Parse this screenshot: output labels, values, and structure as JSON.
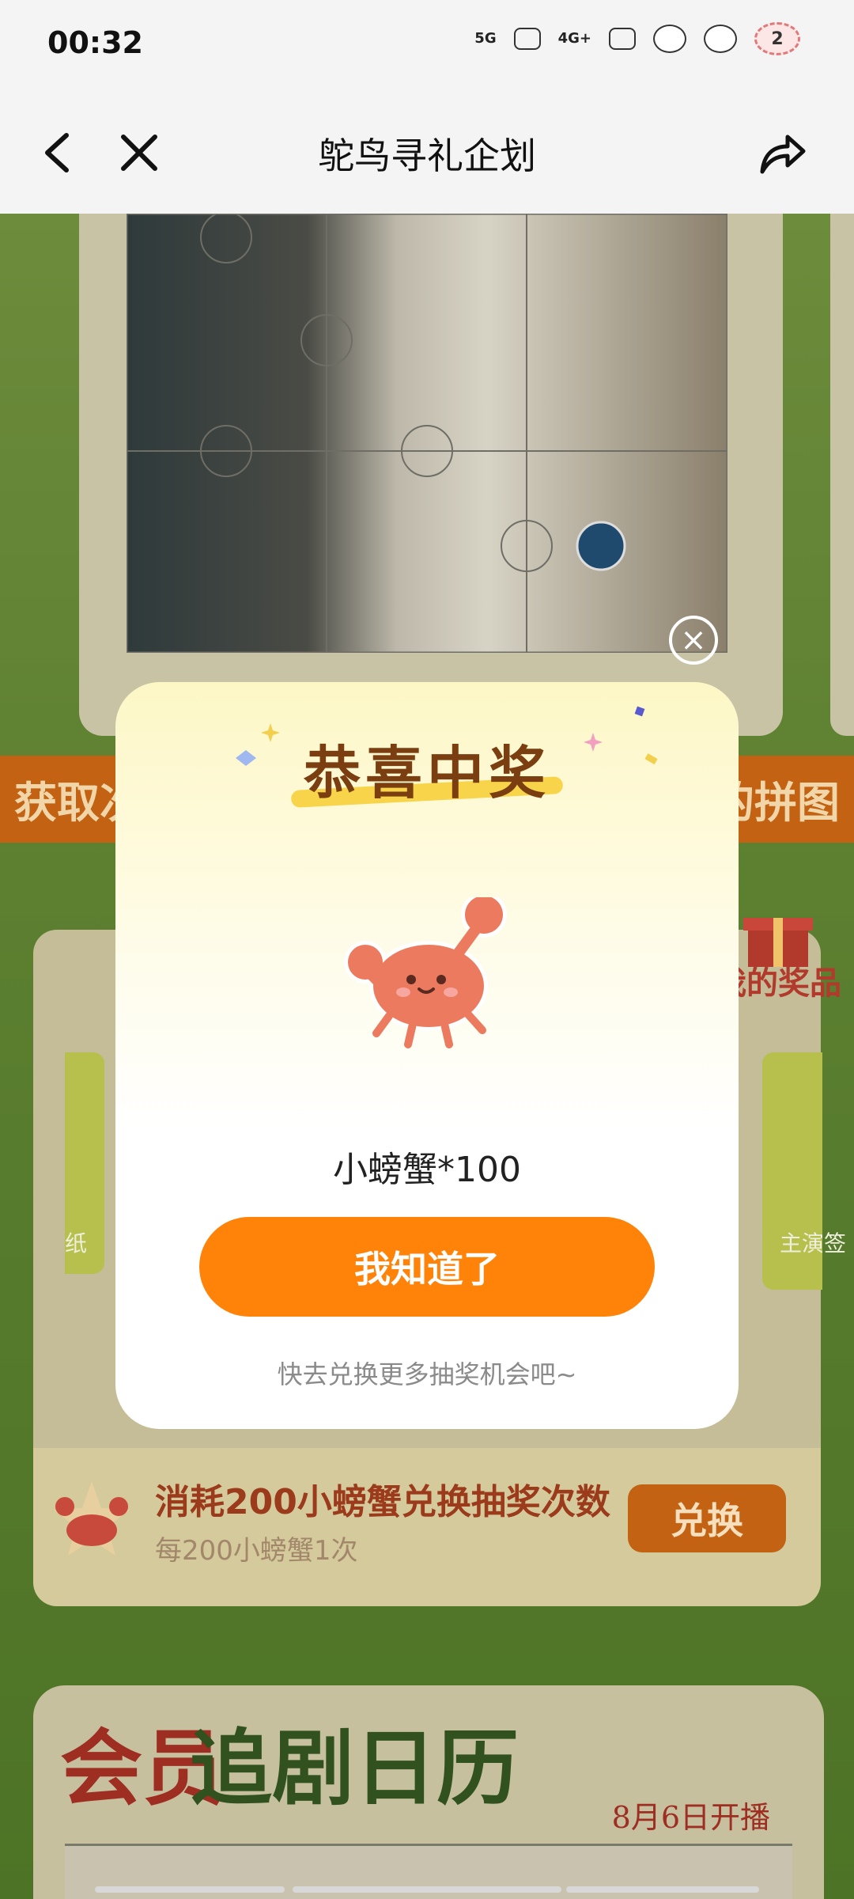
{
  "status_bar": {
    "time": "00:32",
    "signal_1": "5G",
    "signal_2": "4G+",
    "battery": "2"
  },
  "nav": {
    "title": "鸵鸟寻礼企划"
  },
  "background": {
    "banner_left": "获取次",
    "banner_right": "的拼图",
    "my_prize": "我的奖品",
    "card_left_label": "纸",
    "card_right_label": "主演签",
    "exchange_title": "消耗200小螃蟹兑换抽奖次数",
    "exchange_subtitle": "每200小螃蟹1次",
    "exchange_button": "兑换",
    "calendar_title_a": "会员",
    "calendar_title_b": "追剧日历",
    "calendar_date": "8月6日开播"
  },
  "modal": {
    "heading": "恭喜中奖",
    "prize": "小螃蟹*100",
    "ok_button": "我知道了",
    "hint": "快去兑换更多抽奖机会吧~",
    "accent_color": "#ff8209",
    "close_icon": "close-icon"
  }
}
